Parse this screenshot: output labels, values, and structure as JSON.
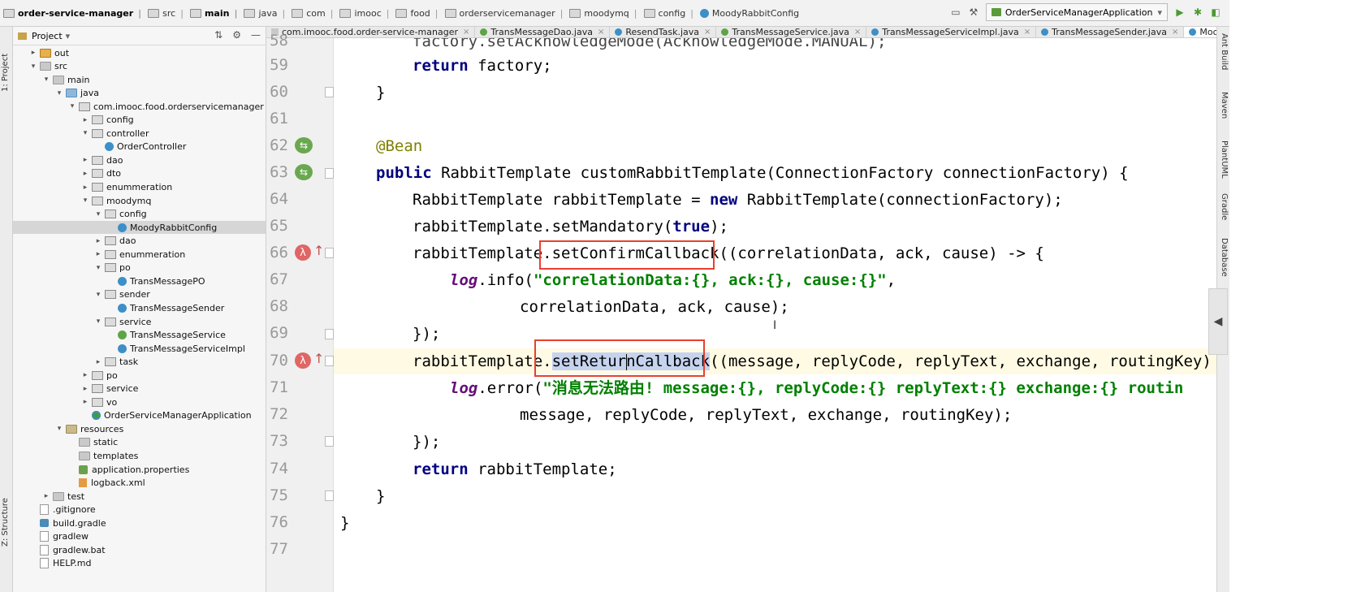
{
  "navbar": {
    "crumbs": [
      "order-service-manager",
      "src",
      "main",
      "java",
      "com",
      "imooc",
      "food",
      "orderservicemanager",
      "moodymq",
      "config",
      "MoodyRabbitConfig"
    ],
    "run_config": "OrderServiceManagerApplication"
  },
  "left_strip": {
    "project_label": "1: Project",
    "structure_label": "Z: Structure"
  },
  "project_panel": {
    "title": "Project",
    "tree": [
      {
        "label": "out",
        "depth": 1,
        "arrow": "right",
        "icon": "out"
      },
      {
        "label": "src",
        "depth": 1,
        "arrow": "down",
        "icon": "folder"
      },
      {
        "label": "main",
        "depth": 2,
        "arrow": "down",
        "icon": "folder"
      },
      {
        "label": "java",
        "depth": 3,
        "arrow": "down",
        "icon": "src"
      },
      {
        "label": "com.imooc.food.orderservicemanager",
        "depth": 4,
        "arrow": "down",
        "icon": "pkg"
      },
      {
        "label": "config",
        "depth": 5,
        "arrow": "right",
        "icon": "pkg"
      },
      {
        "label": "controller",
        "depth": 5,
        "arrow": "down",
        "icon": "pkg"
      },
      {
        "label": "OrderController",
        "depth": 6,
        "arrow": "",
        "icon": "class"
      },
      {
        "label": "dao",
        "depth": 5,
        "arrow": "right",
        "icon": "pkg"
      },
      {
        "label": "dto",
        "depth": 5,
        "arrow": "right",
        "icon": "pkg"
      },
      {
        "label": "enummeration",
        "depth": 5,
        "arrow": "right",
        "icon": "pkg"
      },
      {
        "label": "moodymq",
        "depth": 5,
        "arrow": "down",
        "icon": "pkg"
      },
      {
        "label": "config",
        "depth": 6,
        "arrow": "down",
        "icon": "pkg"
      },
      {
        "label": "MoodyRabbitConfig",
        "depth": 7,
        "arrow": "",
        "icon": "class",
        "selected": true
      },
      {
        "label": "dao",
        "depth": 6,
        "arrow": "right",
        "icon": "pkg"
      },
      {
        "label": "enummeration",
        "depth": 6,
        "arrow": "right",
        "icon": "pkg"
      },
      {
        "label": "po",
        "depth": 6,
        "arrow": "down",
        "icon": "pkg"
      },
      {
        "label": "TransMessagePO",
        "depth": 7,
        "arrow": "",
        "icon": "class"
      },
      {
        "label": "sender",
        "depth": 6,
        "arrow": "down",
        "icon": "pkg"
      },
      {
        "label": "TransMessageSender",
        "depth": 7,
        "arrow": "",
        "icon": "class"
      },
      {
        "label": "service",
        "depth": 6,
        "arrow": "down",
        "icon": "pkg"
      },
      {
        "label": "TransMessageService",
        "depth": 7,
        "arrow": "",
        "icon": "iface"
      },
      {
        "label": "TransMessageServiceImpl",
        "depth": 7,
        "arrow": "",
        "icon": "class"
      },
      {
        "label": "task",
        "depth": 6,
        "arrow": "right",
        "icon": "pkg"
      },
      {
        "label": "po",
        "depth": 5,
        "arrow": "right",
        "icon": "pkg"
      },
      {
        "label": "service",
        "depth": 5,
        "arrow": "right",
        "icon": "pkg"
      },
      {
        "label": "vo",
        "depth": 5,
        "arrow": "right",
        "icon": "pkg"
      },
      {
        "label": "OrderServiceManagerApplication",
        "depth": 5,
        "arrow": "",
        "icon": "springboot"
      },
      {
        "label": "resources",
        "depth": 3,
        "arrow": "down",
        "icon": "res"
      },
      {
        "label": "static",
        "depth": 4,
        "arrow": "",
        "icon": "folder"
      },
      {
        "label": "templates",
        "depth": 4,
        "arrow": "",
        "icon": "folder"
      },
      {
        "label": "application.properties",
        "depth": 4,
        "arrow": "",
        "icon": "prop"
      },
      {
        "label": "logback.xml",
        "depth": 4,
        "arrow": "",
        "icon": "xml"
      },
      {
        "label": "test",
        "depth": 2,
        "arrow": "right",
        "icon": "folder"
      },
      {
        "label": ".gitignore",
        "depth": 1,
        "arrow": "",
        "icon": "file"
      },
      {
        "label": "build.gradle",
        "depth": 1,
        "arrow": "",
        "icon": "gradle"
      },
      {
        "label": "gradlew",
        "depth": 1,
        "arrow": "",
        "icon": "file"
      },
      {
        "label": "gradlew.bat",
        "depth": 1,
        "arrow": "",
        "icon": "file"
      },
      {
        "label": "HELP.md",
        "depth": 1,
        "arrow": "",
        "icon": "file"
      }
    ]
  },
  "tabs": [
    {
      "label": "com.imooc.food.order-service-manager",
      "icon": "m",
      "active": false
    },
    {
      "label": "TransMessageDao.java",
      "icon": "i",
      "active": false
    },
    {
      "label": "ResendTask.java",
      "icon": "c",
      "active": false
    },
    {
      "label": "TransMessageService.java",
      "icon": "i",
      "active": false
    },
    {
      "label": "TransMessageServiceImpl.java",
      "icon": "c",
      "active": false
    },
    {
      "label": "TransMessageSender.java",
      "icon": "c",
      "active": false
    },
    {
      "label": "MoodyRabbitConfig.java",
      "icon": "c",
      "active": true
    }
  ],
  "editor": {
    "line_numbers": [
      "58",
      "59",
      "60",
      "61",
      "62",
      "63",
      "64",
      "65",
      "66",
      "67",
      "68",
      "69",
      "70",
      "71",
      "72",
      "73",
      "74",
      "75",
      "76",
      "77"
    ],
    "code": {
      "l58": "factory.setAcknowledgeMode(AcknowledgeMode.MANUAL);",
      "l59_kw": "return",
      "l59_rest": " factory;",
      "l60": "}",
      "l62": "@Bean",
      "l63_kw": "public",
      "l63_rest": " RabbitTemplate customRabbitTemplate(ConnectionFactory connectionFactory) {",
      "l64_a": "RabbitTemplate rabbitTemplate = ",
      "l64_kw": "new",
      "l64_b": " RabbitTemplate(connectionFactory);",
      "l65_a": "rabbitTemplate.setMandatory(",
      "l65_kw": "true",
      "l65_b": ");",
      "l66_a": "rabbitTemplate.",
      "l66_m": "setConfirmCallback",
      "l66_b": "((correlationData, ack, cause) -> {",
      "l67_f": "log",
      "l67_a": ".info(",
      "l67_s": "\"correlationData:{}, ack:{}, cause:{}\"",
      "l67_b": ",",
      "l68": "correlationData, ack, cause);",
      "l69": "});",
      "l70_a": "rabbitTemplate.",
      "l70_m1": "setRetur",
      "l70_m2": "nCallback",
      "l70_b": "((message, replyCode, replyText, exchange, routingKey) ->",
      "l71_f": "log",
      "l71_a": ".error(",
      "l71_s": "\"消息无法路由! message:{}, replyCode:{} replyText:{} exchange:{} routin",
      "l72": "message, replyCode, replyText, exchange, routingKey);",
      "l73": "});",
      "l74_kw": "return",
      "l74_rest": " rabbitTemplate;",
      "l75": "}",
      "l76": "}"
    }
  },
  "right_tools": [
    "Ant Build",
    "Maven",
    "PlantUML",
    "Gradle",
    "Database"
  ],
  "icons": {
    "collapse": "collapse-left-icon",
    "run": "run-icon",
    "debug": "debug-icon",
    "search": "search-icon"
  }
}
